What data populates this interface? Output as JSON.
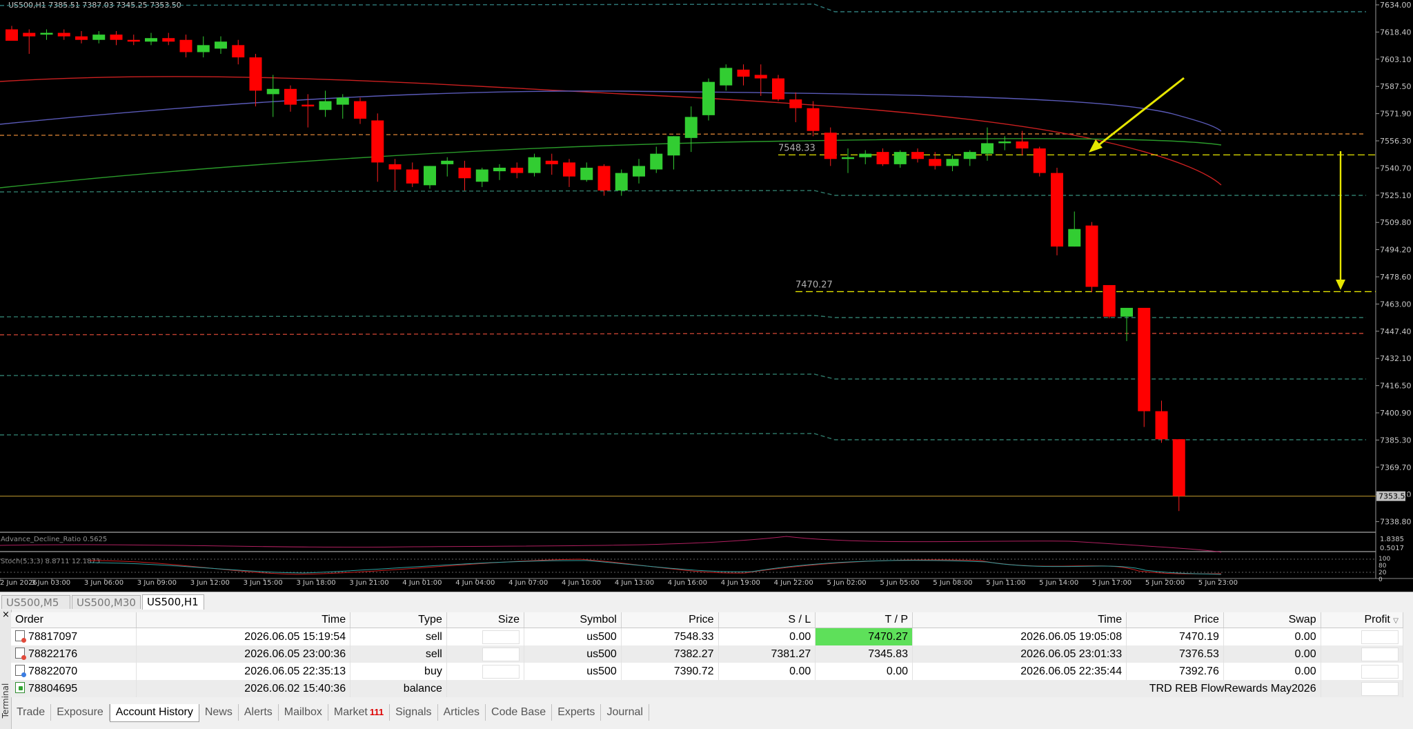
{
  "chart": {
    "header": "US500,H1  7385.51 7387.03 7345.25 7353.50",
    "price_axis": [
      "7634.00",
      "7618.40",
      "7603.10",
      "7587.50",
      "7571.90",
      "7556.30",
      "7540.70",
      "7525.10",
      "7509.80",
      "7494.20",
      "7478.60",
      "7463.00",
      "7447.40",
      "7432.10",
      "7416.50",
      "7400.90",
      "7385.30",
      "7369.70",
      "7354.10",
      "7338.80"
    ],
    "current_price": "7353.50",
    "annotations": {
      "entry": "7548.33",
      "target": "7470.27"
    },
    "time_axis": [
      "2 Jun 2026",
      "3 Jun 03:00",
      "3 Jun 06:00",
      "3 Jun 09:00",
      "3 Jun 12:00",
      "3 Jun 15:00",
      "3 Jun 18:00",
      "3 Jun 21:00",
      "4 Jun 01:00",
      "4 Jun 04:00",
      "4 Jun 07:00",
      "4 Jun 10:00",
      "4 Jun 13:00",
      "4 Jun 16:00",
      "4 Jun 19:00",
      "4 Jun 22:00",
      "5 Jun 02:00",
      "5 Jun 05:00",
      "5 Jun 08:00",
      "5 Jun 11:00",
      "5 Jun 14:00",
      "5 Jun 17:00",
      "5 Jun 20:00",
      "5 Jun 23:00"
    ],
    "indicator1": {
      "label": "Advance_Decline_Ratio 0.5625",
      "axis": [
        "1.8385",
        "0.5017"
      ]
    },
    "indicator2": {
      "label": "Stoch(5,3,3) 8.8711 12.1873",
      "axis": [
        "100",
        "80",
        "20",
        "0"
      ]
    },
    "colors": {
      "bull": "#32cd32",
      "bear": "#ff0000",
      "annotation": "#e6e600"
    }
  },
  "symbol_tabs": [
    "US500,M5",
    "US500,M30",
    "US500,H1"
  ],
  "terminal": {
    "side_label": "Terminal",
    "close_icon": "×",
    "columns": [
      "Order",
      "Time",
      "Type",
      "Size",
      "Symbol",
      "Price",
      "S / L",
      "T / P",
      "Time",
      "Price",
      "Swap",
      "Profit"
    ],
    "rows": [
      {
        "icon": "sell",
        "order": "78817097",
        "time": "2026.06.05 15:19:54",
        "type": "sell",
        "size": "",
        "symbol": "us500",
        "price": "7548.33",
        "sl": "0.00",
        "tp": "7470.27",
        "close_time": "2026.06.05 19:05:08",
        "close_price": "7470.19",
        "swap": "0.00",
        "profit": ""
      },
      {
        "icon": "sell",
        "order": "78822176",
        "time": "2026.06.05 23:00:36",
        "type": "sell",
        "size": "",
        "symbol": "us500",
        "price": "7382.27",
        "sl": "7381.27",
        "tp": "7345.83",
        "close_time": "2026.06.05 23:01:33",
        "close_price": "7376.53",
        "swap": "0.00",
        "profit": ""
      },
      {
        "icon": "buy",
        "order": "78822070",
        "time": "2026.06.05 22:35:13",
        "type": "buy",
        "size": "",
        "symbol": "us500",
        "price": "7390.72",
        "sl": "0.00",
        "tp": "0.00",
        "close_time": "2026.06.05 22:35:44",
        "close_price": "7392.76",
        "swap": "0.00",
        "profit": ""
      }
    ],
    "balance_row": {
      "order": "78804695",
      "time": "2026.06.02 15:40:36",
      "type": "balance",
      "comment": "TRD REB FlowRewards May2026"
    },
    "tabs": [
      {
        "label": "Trade"
      },
      {
        "label": "Exposure"
      },
      {
        "label": "Account History",
        "active": true
      },
      {
        "label": "News"
      },
      {
        "label": "Alerts"
      },
      {
        "label": "Mailbox"
      },
      {
        "label": "Market",
        "badge": "111"
      },
      {
        "label": "Signals"
      },
      {
        "label": "Articles"
      },
      {
        "label": "Code Base"
      },
      {
        "label": "Experts"
      },
      {
        "label": "Journal"
      }
    ]
  }
}
